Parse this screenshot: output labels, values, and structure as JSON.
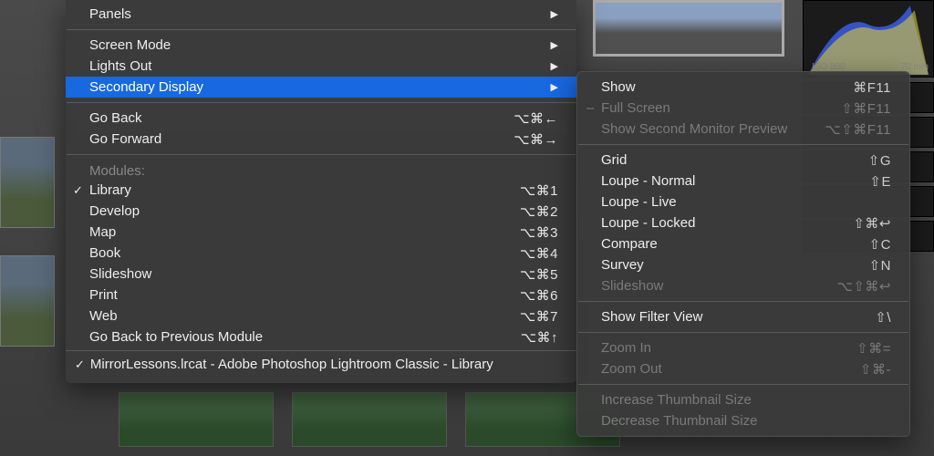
{
  "histogram": {
    "iso_label": "ISO 800",
    "focal_label": "70 mm"
  },
  "menu": {
    "panels": {
      "label": "Panels"
    },
    "screen_mode": {
      "label": "Screen Mode"
    },
    "lights_out": {
      "label": "Lights Out"
    },
    "secondary_display": {
      "label": "Secondary Display"
    },
    "go_back": {
      "label": "Go Back",
      "shortcut": "⌥⌘←"
    },
    "go_forward": {
      "label": "Go Forward",
      "shortcut": "⌥⌘→"
    },
    "modules_label": "Modules:",
    "modules": [
      {
        "label": "Library",
        "shortcut": "⌥⌘1",
        "checked": true
      },
      {
        "label": "Develop",
        "shortcut": "⌥⌘2",
        "checked": false
      },
      {
        "label": "Map",
        "shortcut": "⌥⌘3",
        "checked": false
      },
      {
        "label": "Book",
        "shortcut": "⌥⌘4",
        "checked": false
      },
      {
        "label": "Slideshow",
        "shortcut": "⌥⌘5",
        "checked": false
      },
      {
        "label": "Print",
        "shortcut": "⌥⌘6",
        "checked": false
      },
      {
        "label": "Web",
        "shortcut": "⌥⌘7",
        "checked": false
      }
    ],
    "go_back_module": {
      "label": "Go Back to Previous Module",
      "shortcut": "⌥⌘↑"
    },
    "footer": "MirrorLessons.lrcat - Adobe Photoshop Lightroom Classic - Library"
  },
  "submenu": {
    "show": {
      "label": "Show",
      "shortcut": "⌘F11"
    },
    "full_screen": {
      "label": "Full Screen",
      "shortcut": "⇧⌘F11",
      "disabled": true,
      "dash": true
    },
    "second_monitor": {
      "label": "Show Second Monitor Preview",
      "shortcut": "⌥⇧⌘F11",
      "disabled": true
    },
    "grid": {
      "label": "Grid",
      "shortcut": "⇧G"
    },
    "loupe_normal": {
      "label": "Loupe - Normal",
      "shortcut": "⇧E"
    },
    "loupe_live": {
      "label": "Loupe - Live",
      "shortcut": ""
    },
    "loupe_locked": {
      "label": "Loupe - Locked",
      "shortcut": "⇧⌘↩"
    },
    "compare": {
      "label": "Compare",
      "shortcut": "⇧C"
    },
    "survey": {
      "label": "Survey",
      "shortcut": "⇧N"
    },
    "slideshow": {
      "label": "Slideshow",
      "shortcut": "⌥⇧⌘↩",
      "disabled": true
    },
    "show_filter": {
      "label": "Show Filter View",
      "shortcut": "⇧\\"
    },
    "zoom_in": {
      "label": "Zoom In",
      "shortcut": "⇧⌘=",
      "disabled": true
    },
    "zoom_out": {
      "label": "Zoom Out",
      "shortcut": "⇧⌘-",
      "disabled": true
    },
    "inc_thumb": {
      "label": "Increase Thumbnail Size",
      "disabled": true
    },
    "dec_thumb": {
      "label": "Decrease Thumbnail Size",
      "disabled": true
    }
  }
}
